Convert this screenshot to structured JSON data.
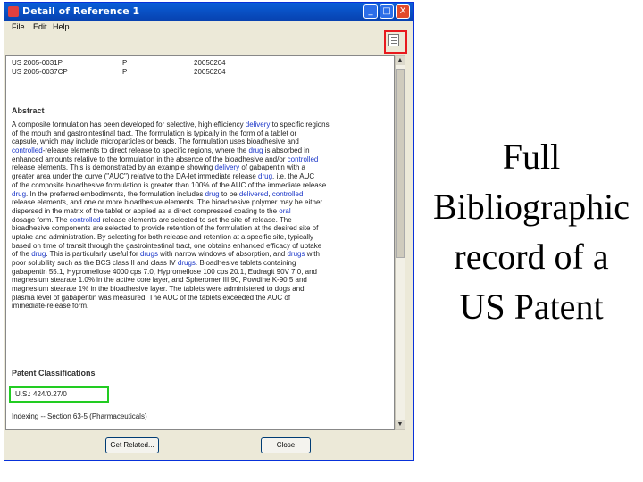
{
  "window": {
    "title": "Detail of Reference 1",
    "minimize_glyph": "_",
    "maximize_glyph": "□",
    "close_glyph": "X"
  },
  "menu": {
    "items": [
      "File",
      "Edit",
      "Help"
    ]
  },
  "records": [
    {
      "id": "US 2005-0031P",
      "type": "P",
      "date": "20050204"
    },
    {
      "id": "US 2005-0037CP",
      "type": "P",
      "date": "20050204"
    }
  ],
  "abstract": {
    "heading": "Abstract",
    "lines": [
      [
        {
          "t": "A composite formulation has been developed for selective, high efficiency "
        },
        {
          "t": "delivery",
          "h": true
        },
        {
          "t": " to specific regions"
        }
      ],
      [
        {
          "t": "of the mouth and gastrointestinal tract. The formulation is typically in the form of a tablet or"
        }
      ],
      [
        {
          "t": "capsule, which may include microparticles or beads. The formulation uses bioadhesive and"
        }
      ],
      [
        {
          "t": "controlled",
          "h": true
        },
        {
          "t": "-release elements to direct release to specific regions, where the "
        },
        {
          "t": "drug",
          "h": true
        },
        {
          "t": " is absorbed in"
        }
      ],
      [
        {
          "t": "enhanced amounts relative to the formulation in the absence of the bioadhesive and/or "
        },
        {
          "t": "controlled",
          "h": true
        }
      ],
      [
        {
          "t": "release elements. This is demonstrated by an example showing "
        },
        {
          "t": "delivery",
          "h": true
        },
        {
          "t": " of gabapentin with a"
        }
      ],
      [
        {
          "t": "greater area under the curve (\"AUC\") relative to the DA-let immediate release "
        },
        {
          "t": "drug",
          "h": true
        },
        {
          "t": ", i.e. the AUC"
        }
      ],
      [
        {
          "t": "of the composite bioadhesive formulation is greater than 100% of the AUC of the immediate release"
        }
      ],
      [
        {
          "t": "drug",
          "h": true
        },
        {
          "t": ". In the preferred embodiments, the formulation includes "
        },
        {
          "t": "drug",
          "h": true
        },
        {
          "t": " to be "
        },
        {
          "t": "delivered",
          "h": true
        },
        {
          "t": ", "
        },
        {
          "t": "controlled",
          "h": true
        }
      ],
      [
        {
          "t": "release elements, and one or more bioadhesive elements. The bioadhesive polymer may be either"
        }
      ],
      [
        {
          "t": "dispersed in the matrix of the tablet or applied as a direct compressed coating to the "
        },
        {
          "t": "oral",
          "h": true
        }
      ],
      [
        {
          "t": "dosage form. The "
        },
        {
          "t": "controlled",
          "h": true
        },
        {
          "t": " release elements are selected to set the site of release. The"
        }
      ],
      [
        {
          "t": "bioadhesive components are selected to provide retention of the formulation at the desired site of"
        }
      ],
      [
        {
          "t": "uptake and administration. By selecting for both release and retention at a specific site, typically"
        }
      ],
      [
        {
          "t": "based on time of transit through the gastrointestinal tract, one obtains enhanced efficacy of uptake"
        }
      ],
      [
        {
          "t": "of the "
        },
        {
          "t": "drug",
          "h": true
        },
        {
          "t": ". This is particularly useful for "
        },
        {
          "t": "drugs",
          "h": true
        },
        {
          "t": " with narrow windows of absorption, and "
        },
        {
          "t": "drugs",
          "h": true
        },
        {
          "t": " with"
        }
      ],
      [
        {
          "t": "poor solubility such as the BCS class II and class IV "
        },
        {
          "t": "drugs",
          "h": true
        },
        {
          "t": ". Bioadhesive tablets containing"
        }
      ],
      [
        {
          "t": "gabapentin 55.1, Hypromellose 4000 cps 7.0, Hypromellose 100 cps 20.1, Eudragit 90V 7.0, and"
        }
      ],
      [
        {
          "t": "magnesium stearate 1.0% in the active core layer, and Spheromer III 90, Powdine K-90 5 and"
        }
      ],
      [
        {
          "t": "magnesium stearate 1% in the bioadhesive layer. The tablets were administered to dogs and"
        }
      ],
      [
        {
          "t": "plasma level of gabapentin was measured. The AUC of the tablets exceeded the AUC of"
        }
      ],
      [
        {
          "t": "immediate-release form."
        }
      ]
    ]
  },
  "classifications": {
    "heading": "Patent Classifications",
    "us_class": "U.S.: 424/0.27/0",
    "indexing": "Indexing -- Section 63-5 (Pharmaceuticals)"
  },
  "buttons": {
    "get_related": "Get Related...",
    "close": "Close"
  },
  "caption": {
    "lines": [
      "Full",
      "Bibliographic",
      "record of a",
      "US Patent"
    ]
  },
  "colors": {
    "highlight_term": "#1a36c8",
    "annotation_red": "#e8191e",
    "annotation_green": "#22cc22",
    "titlebar": "#0a5fd8"
  }
}
